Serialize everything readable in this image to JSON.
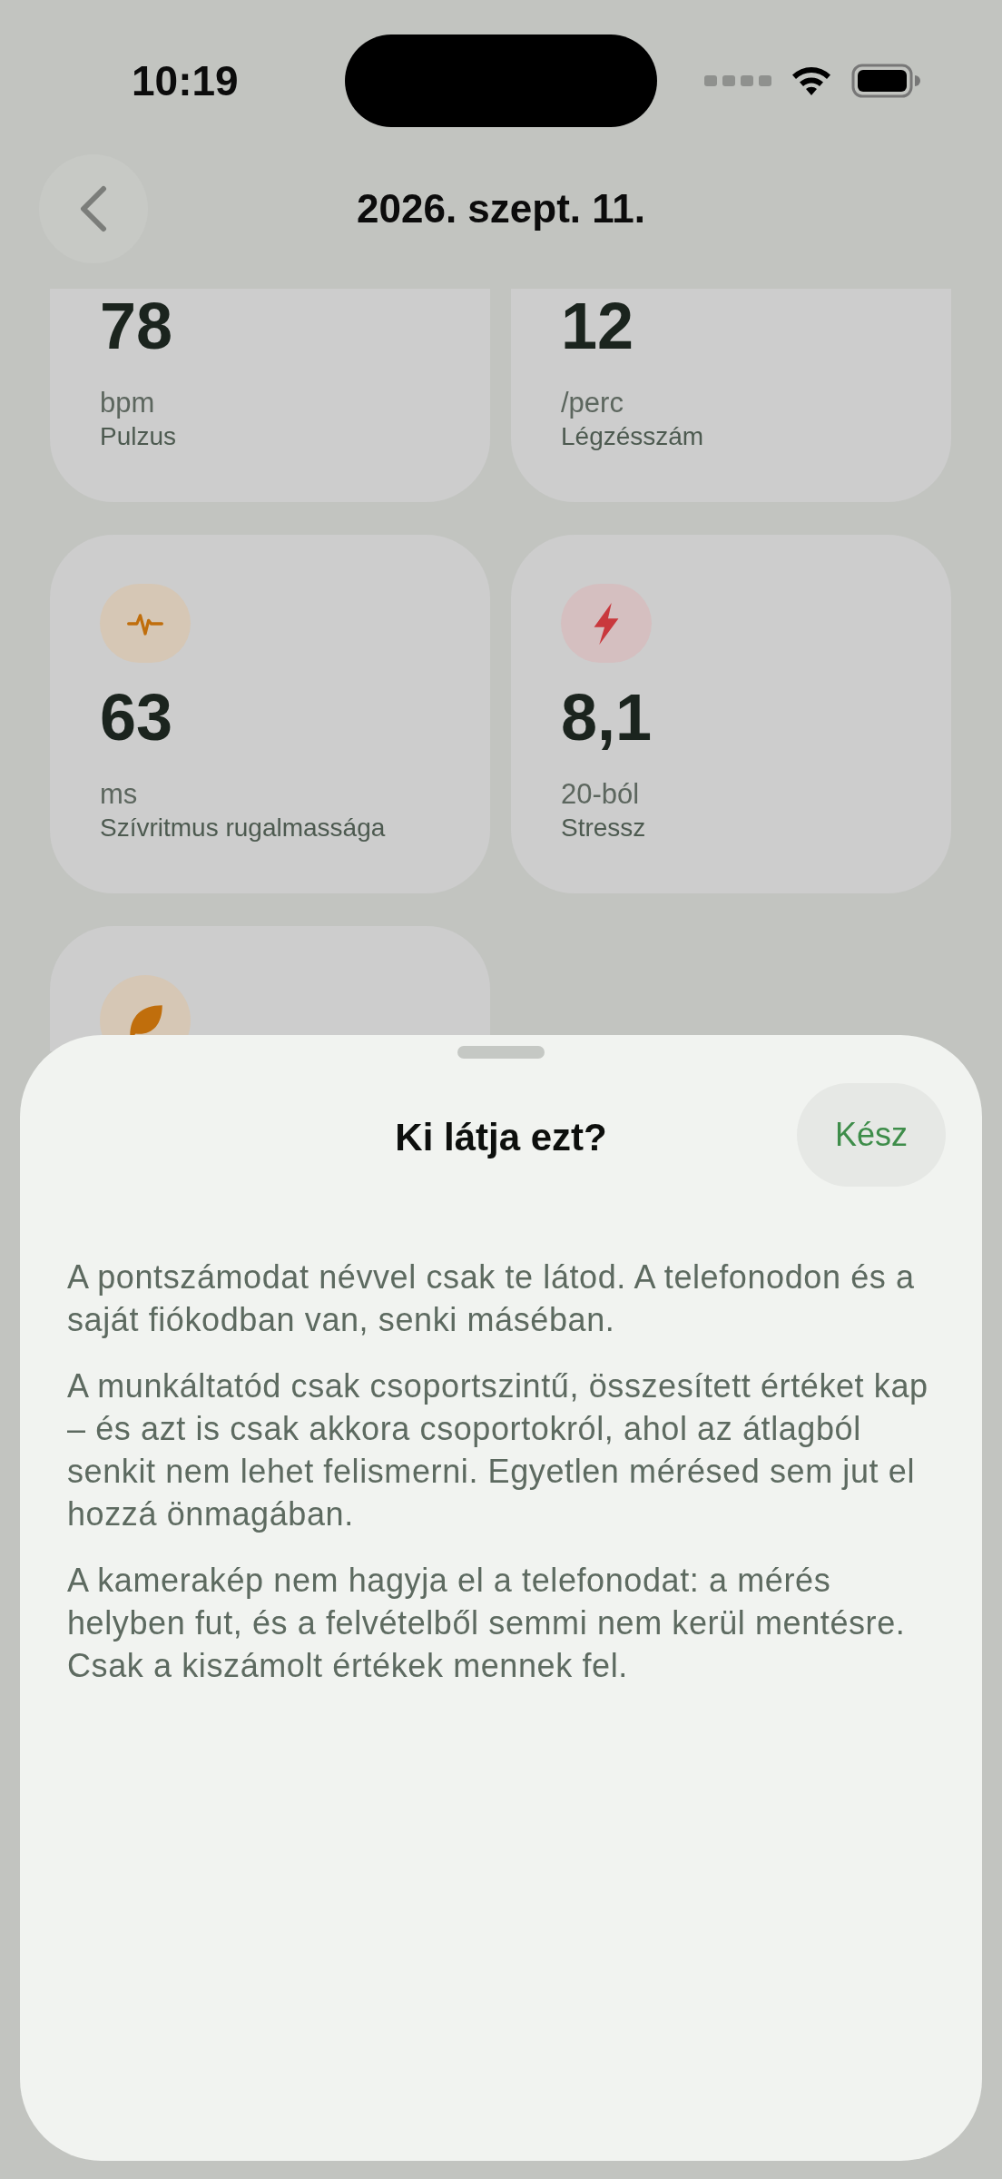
{
  "status_bar": {
    "time": "10:19"
  },
  "header": {
    "title": "2026. szept. 11."
  },
  "cards": [
    {
      "value": "78",
      "unit": "bpm",
      "label": "Pulzus"
    },
    {
      "value": "12",
      "unit": "/perc",
      "label": "Légzésszám"
    },
    {
      "kind": "pulse",
      "value": "63",
      "unit": "ms",
      "label": "Szívritmus rugalmassága"
    },
    {
      "kind": "bolt",
      "value": "8,1",
      "unit": "20-ból",
      "label": "Stressz"
    },
    {
      "kind": "leaf"
    }
  ],
  "sheet": {
    "title": "Ki látja ezt?",
    "done_button": "Kész",
    "paragraphs": [
      "A pontszámodat névvel csak te látod. A telefonodon és a saját fiókodban van, senki máséban.",
      "A munkáltatód csak csoportszintű, összesített értéket kap – és azt is csak akkora csoportokról, ahol az átlagból senkit nem lehet felismerni. Egyetlen mérésed sem jut el hozzá önmagában.",
      "A kamerakép nem hagyja el a telefonodat: a mérés helyben fut, és a felvételből semmi nem kerül mentésre. Csak a kiszámolt értékek mennek fel."
    ]
  }
}
